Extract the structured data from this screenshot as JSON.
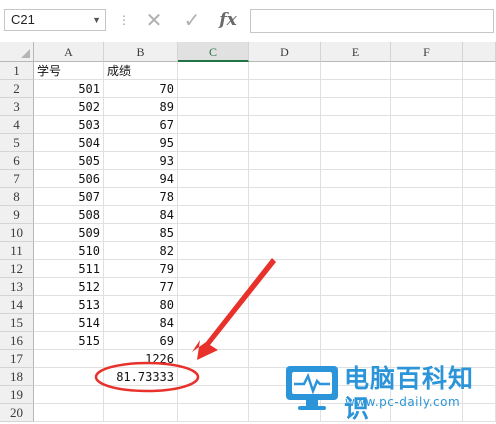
{
  "formula_bar": {
    "name_box": "C21",
    "cancel_icon": "✕",
    "enter_icon": "✓",
    "fx_label": "fx",
    "formula": ""
  },
  "columns": [
    "A",
    "B",
    "C",
    "D",
    "E",
    "F"
  ],
  "active_column": "C",
  "rows": [
    {
      "n": "1",
      "a": "学号",
      "b": "成绩"
    },
    {
      "n": "2",
      "a": "501",
      "b": "70"
    },
    {
      "n": "3",
      "a": "502",
      "b": "89"
    },
    {
      "n": "4",
      "a": "503",
      "b": "67"
    },
    {
      "n": "5",
      "a": "504",
      "b": "95"
    },
    {
      "n": "6",
      "a": "505",
      "b": "93"
    },
    {
      "n": "7",
      "a": "506",
      "b": "94"
    },
    {
      "n": "8",
      "a": "507",
      "b": "78"
    },
    {
      "n": "9",
      "a": "508",
      "b": "84"
    },
    {
      "n": "10",
      "a": "509",
      "b": "85"
    },
    {
      "n": "11",
      "a": "510",
      "b": "82"
    },
    {
      "n": "12",
      "a": "511",
      "b": "79"
    },
    {
      "n": "13",
      "a": "512",
      "b": "77"
    },
    {
      "n": "14",
      "a": "513",
      "b": "80"
    },
    {
      "n": "15",
      "a": "514",
      "b": "84"
    },
    {
      "n": "16",
      "a": "515",
      "b": "69"
    },
    {
      "n": "17",
      "a": "",
      "b": "1226"
    },
    {
      "n": "18",
      "a": "",
      "b": "81.73333"
    },
    {
      "n": "19",
      "a": "",
      "b": ""
    },
    {
      "n": "20",
      "a": "",
      "b": ""
    }
  ],
  "annotation": {
    "color": "#e8312b"
  },
  "watermark": {
    "title": "电脑百科知识",
    "url": "www.pc-daily.com",
    "color": "#2c94d8"
  }
}
